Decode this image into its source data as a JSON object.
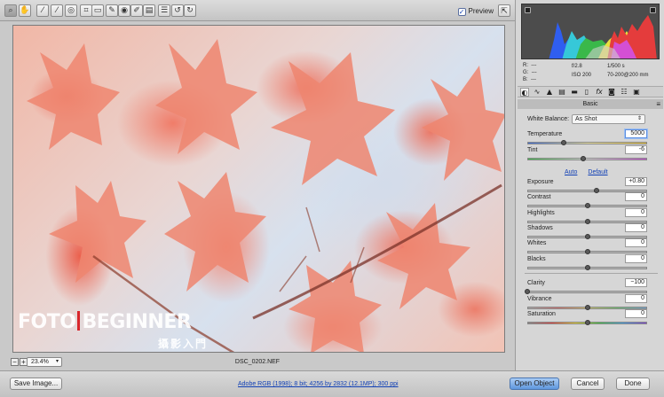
{
  "toolbar": {
    "tools": [
      {
        "icon": "zoom-icon",
        "glyph": "⌕"
      },
      {
        "icon": "hand-icon",
        "glyph": "✋"
      },
      {
        "icon": "white-balance-icon",
        "glyph": "⁄"
      },
      {
        "icon": "color-sampler-icon",
        "glyph": "⁄"
      },
      {
        "icon": "targeted-adjustment-icon",
        "glyph": "◎"
      },
      {
        "icon": "crop-icon",
        "glyph": "⌗"
      },
      {
        "icon": "straighten-icon",
        "glyph": "▭"
      },
      {
        "icon": "spot-removal-icon",
        "glyph": "✎"
      },
      {
        "icon": "red-eye-icon",
        "glyph": "◉"
      },
      {
        "icon": "adjustment-brush-icon",
        "glyph": "✐"
      },
      {
        "icon": "graduated-filter-icon",
        "glyph": "▤"
      },
      {
        "icon": "preferences-icon",
        "glyph": "☰"
      },
      {
        "icon": "rotate-left-icon",
        "glyph": "↺"
      },
      {
        "icon": "rotate-right-icon",
        "glyph": "↻"
      }
    ],
    "preview_label": "Preview",
    "preview_check": "✓",
    "fullscreen_glyph": "⇱"
  },
  "watermark": {
    "left": "FOTO",
    "right": "BEGINNER",
    "sub": "攝影入門"
  },
  "zoom": {
    "minus": "−",
    "plus": "+",
    "level": "23.4%",
    "arrow": "▾"
  },
  "filename": "DSC_0202.NEF",
  "bottombar": {
    "save_image": "Save Image...",
    "workflow": "Adobe RGB (1998); 8 bit; 4256 by 2832 (12.1MP); 300 ppi",
    "open_object": "Open Object",
    "cancel": "Cancel",
    "done": "Done"
  },
  "info": {
    "r_label": "R:",
    "g_label": "G:",
    "b_label": "B:",
    "r_value": "---",
    "g_value": "---",
    "b_value": "---",
    "aperture": "f/2.8",
    "shutter": "1/500 s",
    "iso": "ISO 200",
    "lens": "70-200@200 mm"
  },
  "panel": {
    "tabs": [
      {
        "icon": "basic-tab-icon",
        "glyph": "◐"
      },
      {
        "icon": "tone-curve-tab-icon",
        "glyph": "∿"
      },
      {
        "icon": "detail-tab-icon",
        "glyph": "▲"
      },
      {
        "icon": "hsl-tab-icon",
        "glyph": "▤"
      },
      {
        "icon": "split-toning-tab-icon",
        "glyph": "▬"
      },
      {
        "icon": "lens-corrections-tab-icon",
        "glyph": "▯"
      },
      {
        "icon": "effects-tab-icon",
        "glyph": "fx"
      },
      {
        "icon": "camera-calibration-tab-icon",
        "glyph": "◙"
      },
      {
        "icon": "presets-tab-icon",
        "glyph": "☷"
      },
      {
        "icon": "snapshots-tab-icon",
        "glyph": "▣"
      }
    ],
    "section_title": "Basic",
    "section_menu": "≡",
    "white_balance_label": "White Balance:",
    "white_balance_value": "As Shot",
    "auto_label": "Auto",
    "default_label": "Default",
    "sliders": {
      "temperature": {
        "label": "Temperature",
        "value": "5000",
        "level": 0.3
      },
      "tint": {
        "label": "Tint",
        "value": "-6",
        "level": 0.47
      },
      "exposure": {
        "label": "Exposure",
        "value": "+0.80",
        "level": 0.58
      },
      "contrast": {
        "label": "Contrast",
        "value": "0",
        "level": 0.5
      },
      "highlights": {
        "label": "Highlights",
        "value": "0",
        "level": 0.5
      },
      "shadows": {
        "label": "Shadows",
        "value": "0",
        "level": 0.5
      },
      "whites": {
        "label": "Whites",
        "value": "0",
        "level": 0.5
      },
      "blacks": {
        "label": "Blacks",
        "value": "0",
        "level": 0.5
      },
      "clarity": {
        "label": "Clarity",
        "value": "−100",
        "level": 0.0
      },
      "vibrance": {
        "label": "Vibrance",
        "value": "0",
        "level": 0.5
      },
      "saturation": {
        "label": "Saturation",
        "value": "0",
        "level": 0.5
      }
    }
  }
}
